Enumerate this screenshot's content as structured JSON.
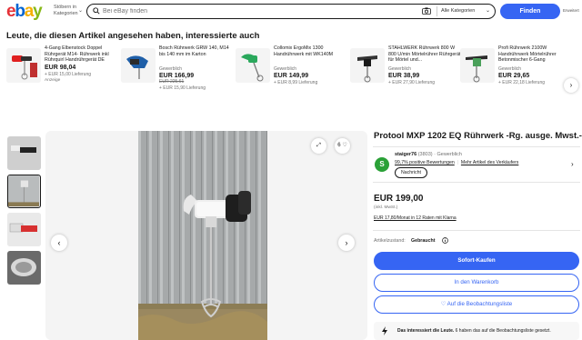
{
  "header": {
    "logo_letters": [
      "e",
      "b",
      "a",
      "y"
    ],
    "browse_label": "Stöbern in Kategorien",
    "search_placeholder": "Bei eBay finden",
    "category_label": "Alle Kategorien",
    "find_button": "Finden",
    "advanced_label": "Erweitert"
  },
  "recently_viewed": {
    "title": "Leute, die diesen Artikel angesehen haben, interessierte auch",
    "items": [
      {
        "name": "4-Gang Elbenstock Doppel Rührgerät M14- Rührwerk inkl Rührquirl Handrührgerät DE",
        "condition": "",
        "price": "EUR 98,04",
        "old_price": "",
        "shipping": "+ EUR 15,00 Lieferung",
        "ad": "Anzeige"
      },
      {
        "name": "Bosch Rührwerk GRW 140, M14 bis 140 mm im Karton",
        "condition": "Gewerblich",
        "price": "EUR 166,99",
        "old_price": "EUR 225,61",
        "shipping": "+ EUR 15,90 Lieferung",
        "ad": ""
      },
      {
        "name": "Collomix ErgoMix 1300 Handrührwerk mit WK140M",
        "condition": "Gewerblich",
        "price": "EUR 149,99",
        "old_price": "",
        "shipping": "+ EUR 8,99 Lieferung",
        "ad": ""
      },
      {
        "name": "STAHLWERK Rührwerk 800 W 800 U/min Mörtelrührer Rührgerät für Mörtel und...",
        "condition": "Gewerblich",
        "price": "EUR 38,99",
        "old_price": "",
        "shipping": "+ EUR 27,90 Lieferung",
        "ad": ""
      },
      {
        "name": "Profi Rührwerk 2100W Handrührwerk Mörtelrührer Betonmischer 6-Gang Rührgerät...",
        "condition": "Gewerblich",
        "price": "EUR 29,65",
        "old_price": "",
        "shipping": "+ EUR 22,18 Lieferung",
        "ad": ""
      }
    ],
    "next_icon": "›"
  },
  "gallery": {
    "prev_icon": "‹",
    "next_icon": "›",
    "expand_icon": "⤢",
    "favorite_count": "6"
  },
  "listing": {
    "title": "Protool MXP 1202 EQ Rührwerk -Rg. ausge. Mwst.-",
    "seller": {
      "avatar_letter": "S",
      "name": "staiger76",
      "score": "(3803)",
      "type": "· Gewerblich",
      "feedback_link": "99,7% positive Bewertungen",
      "more_link": "Mehr Artikel des Verkäufers",
      "message_button": "Nachricht",
      "chevron": "›"
    },
    "price": "EUR 199,00",
    "vat": "(inkl. MwSt.)",
    "financing": "EUR 17,80/Monat in 12 Raten mit Klarna",
    "condition_label": "Artikelzustand:",
    "condition_value": "Gebraucht",
    "buy_now": "Sofort-Kaufen",
    "add_to_cart": "In den Warenkorb",
    "watch": "♡ Auf die Beobachtungsliste",
    "interest_bold": "Das interessiert die Leute.",
    "interest_rest": " 6 haben das auf die Beobachtungsliste gesetzt."
  },
  "colors": {
    "accent": "#3665f3",
    "logo_red": "#e53238",
    "logo_blue": "#0064d2",
    "logo_yellow": "#f5af02",
    "logo_green": "#86b817"
  }
}
